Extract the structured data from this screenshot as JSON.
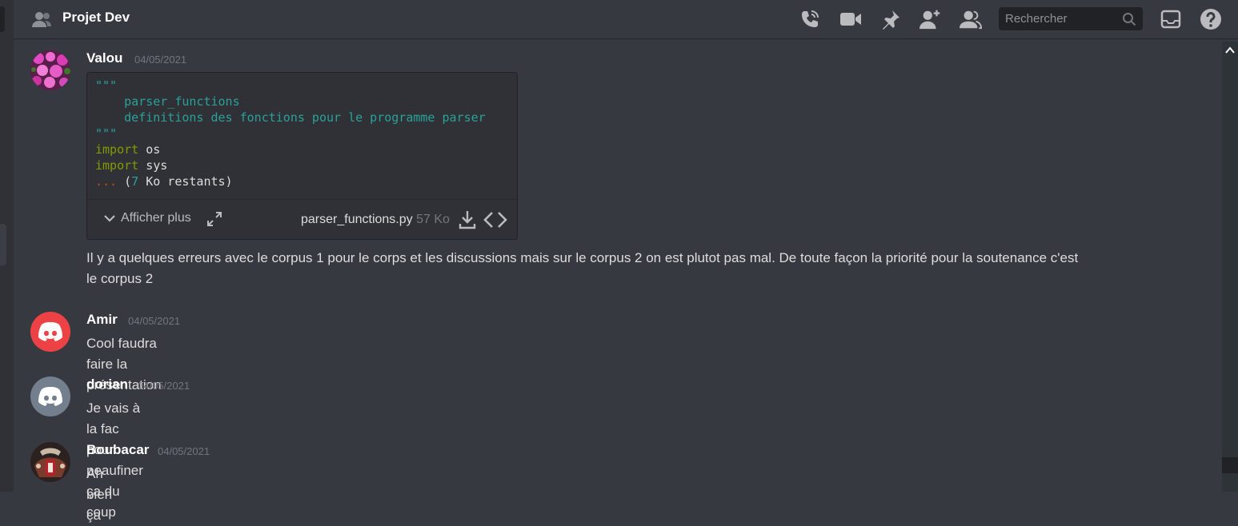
{
  "header": {
    "title": "Projet Dev",
    "icons": [
      "group-icon",
      "call-icon",
      "video-icon",
      "pin-icon",
      "add-member-icon",
      "members-icon",
      "inbox-icon",
      "help-icon"
    ],
    "search": {
      "placeholder": "Rechercher"
    }
  },
  "messages": [
    {
      "user": "Valou",
      "timestamp": "04/05/2021",
      "code": {
        "line1": "\"\"\"",
        "line2": "    parser_functions",
        "line3": "    definitions des fonctions pour le programme parser",
        "line4": "\"\"\"",
        "line5_kw": "import",
        "line5_rest": " os",
        "line6_kw": "import",
        "line6_rest": " sys",
        "line7_dots": "...",
        "line7_a": " (",
        "line7_num": "7",
        "line7_b": " Ko restants)",
        "expand_label": "Afficher plus",
        "filename": "parser_functions.py",
        "filesize": "57 Ko"
      },
      "text_line1": "Il y a quelques erreurs avec le corpus 1 pour le corps et les discussions mais sur le corpus 2 on est plutot pas mal. De toute façon la priorité pour la soutenance c'est",
      "text_line2": "le corpus 2"
    },
    {
      "user": "Amir",
      "timestamp": "04/05/2021",
      "text": "Cool faudra faire la présentation"
    },
    {
      "user": "dorian",
      "timestamp": "04/05/2021",
      "text": "Je vais à la fac pour peaufiner ça du coup"
    },
    {
      "user": "Boubacar",
      "timestamp": "04/05/2021",
      "text": "Ah bien ça"
    }
  ],
  "colors": {
    "background": "#36393f",
    "amir_avatar": "#ed4245",
    "dorian_avatar": "#747f8d"
  }
}
